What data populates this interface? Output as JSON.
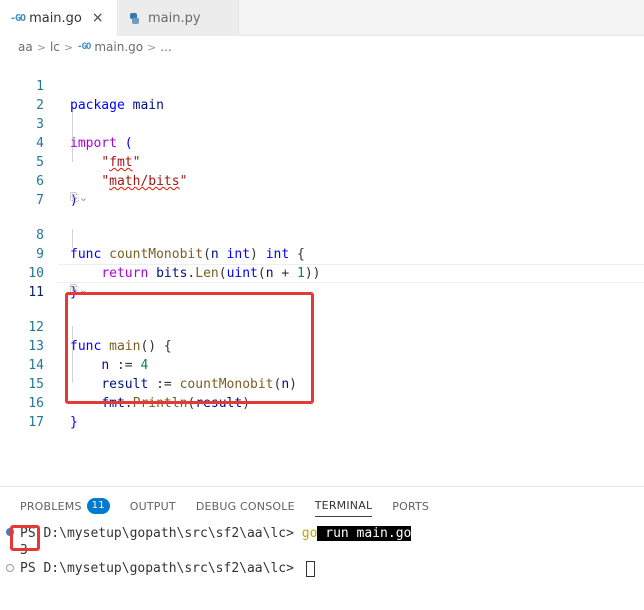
{
  "tabs": [
    {
      "icon": "go-icon",
      "glyph": "-GO",
      "label": "main.go",
      "close": "×",
      "active": true
    },
    {
      "icon": "python-icon",
      "label": "main.py",
      "active": false
    }
  ],
  "breadcrumb": {
    "parts": [
      "aa",
      "lc"
    ],
    "file_glyph": "-GO",
    "file": "main.go",
    "ellipsis": "...",
    "separator": ">"
  },
  "editor": {
    "lines": [
      {
        "n": "1",
        "text": "package main"
      },
      {
        "n": "2",
        "text": ""
      },
      {
        "n": "3",
        "text": "import ("
      },
      {
        "n": "4",
        "text": "    \"fmt\""
      },
      {
        "n": "5",
        "text": "    \"math/bits\""
      },
      {
        "n": "6",
        "text": ")"
      },
      {
        "n": "7",
        "text": ""
      },
      {
        "n": "8",
        "text": "func countMonobit(n int) int {"
      },
      {
        "n": "9",
        "text": "    return bits.Len(uint(n + 1))"
      },
      {
        "n": "10",
        "text": "}"
      },
      {
        "n": "11",
        "text": ""
      },
      {
        "n": "12",
        "text": "func main() {"
      },
      {
        "n": "13",
        "text": "    n := 4"
      },
      {
        "n": "14",
        "text": "    result := countMonobit(n)"
      },
      {
        "n": "15",
        "text": "    fmt.Println(result)"
      },
      {
        "n": "16",
        "text": "}"
      },
      {
        "n": "17",
        "text": ""
      }
    ],
    "codelens": "⎘⌄"
  },
  "panel": {
    "tabs": [
      {
        "label": "PROBLEMS",
        "badge": "11"
      },
      {
        "label": "OUTPUT"
      },
      {
        "label": "DEBUG CONSOLE"
      },
      {
        "label": "TERMINAL",
        "active": true
      },
      {
        "label": "PORTS"
      }
    ],
    "terminal": {
      "prompt1": "PS D:\\mysetup\\gopath\\src\\sf2\\aa\\lc> ",
      "cmd_go": "go",
      "cmd_rest": " run main.go",
      "output": "3",
      "prompt2": "PS D:\\mysetup\\gopath\\src\\sf2\\aa\\lc> "
    }
  },
  "colors": {
    "accent": "#007acc",
    "highlight_box": "#e53935"
  }
}
